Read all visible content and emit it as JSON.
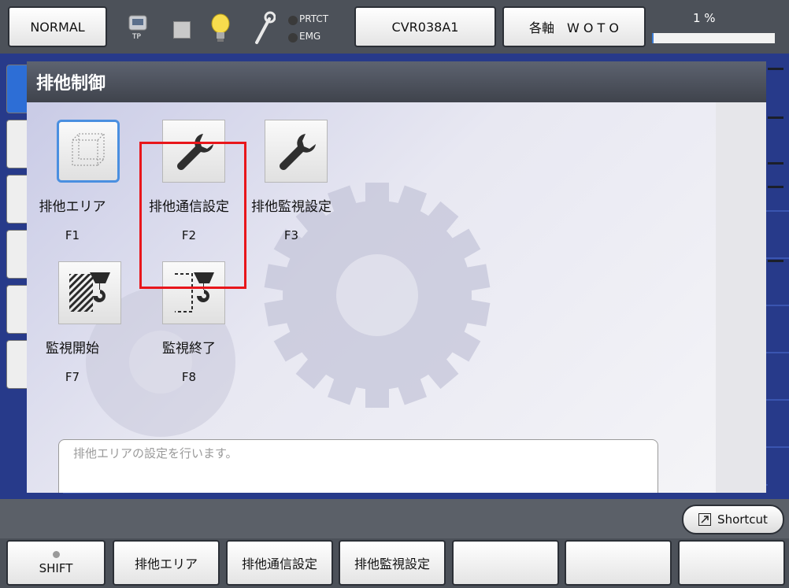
{
  "header": {
    "mode_label": "NORMAL",
    "tp_label": "TP",
    "prtct_label": "PRTCT",
    "emg_label": "EMG",
    "program_label": "CVR038A1",
    "jog_label": "各軸　W O T O",
    "speed_label": "1 %",
    "speed_value": 0.01
  },
  "dialog": {
    "title": "排他制御",
    "items": [
      {
        "label": "排他エリア",
        "key": "F1",
        "icon": "area-box-icon"
      },
      {
        "label": "排他通信設定",
        "key": "F2",
        "icon": "wrench-icon"
      },
      {
        "label": "排他監視設定",
        "key": "F3",
        "icon": "wrench-icon"
      },
      {
        "label": "監視開始",
        "key": "F7",
        "icon": "monitor-start-icon"
      },
      {
        "label": "監視終了",
        "key": "F8",
        "icon": "monitor-end-icon"
      }
    ],
    "description": "排他エリアの設定を行います。"
  },
  "shortcut": {
    "label": "Shortcut",
    "icon": "shortcut-icon"
  },
  "fkeys": {
    "shift": "SHIFT",
    "f1": "排他エリア",
    "f2": "排他通信設定",
    "f3": "排他監視設定",
    "f4": "",
    "f5": "",
    "f6": ""
  },
  "colors": {
    "accent": "#4a8fe0",
    "highlight": "#e8161b",
    "title_bar": "#4c5159"
  }
}
